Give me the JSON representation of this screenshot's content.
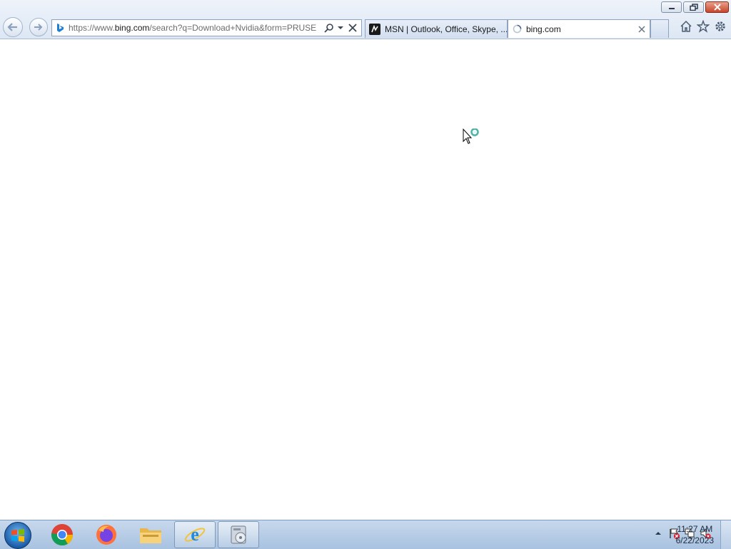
{
  "browser": {
    "address_bar": {
      "url_prefix": "https://www.",
      "url_domain": "bing.com",
      "url_rest": "/search?q=Download+Nvidia&form=PRUSE"
    },
    "tabs": [
      {
        "label": "MSN | Outlook, Office, Skype, ...",
        "active": false
      },
      {
        "label": "bing.com",
        "active": true,
        "loading": true
      }
    ]
  },
  "taskbar": {
    "apps": [
      {
        "name": "Google Chrome",
        "icon": "chrome-icon",
        "open": false
      },
      {
        "name": "Firefox",
        "icon": "firefox-icon",
        "open": false
      },
      {
        "name": "Windows Explorer",
        "icon": "folder-icon",
        "open": false
      },
      {
        "name": "Internet Explorer",
        "icon": "ie-icon",
        "open": true
      },
      {
        "name": "Media Player",
        "icon": "media-player-icon",
        "open": true
      }
    ],
    "clock": {
      "time": "11:27 AM",
      "date": "6/22/2023"
    }
  },
  "colors": {
    "accent": "#1b5da8",
    "taskbar": "#b6cbe5",
    "close": "#c8452b"
  }
}
